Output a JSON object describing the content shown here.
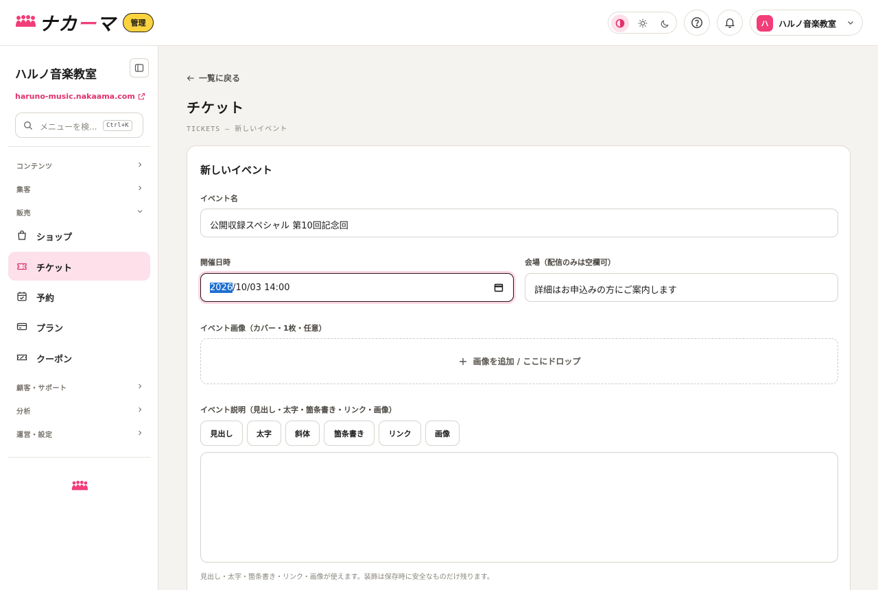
{
  "header": {
    "brand_prefix": "ナカ",
    "brand_accent": "ー",
    "brand_suffix": "マ",
    "admin_badge": "管理",
    "account_avatar": "ハ",
    "account_name": "ハルノ音楽教室",
    "theme_options": [
      "contrast",
      "light",
      "dark"
    ],
    "active_theme": "contrast"
  },
  "sidebar": {
    "title": "ハルノ音楽教室",
    "site_link": "haruno-music.nakaama.com",
    "search_placeholder": "メニューを検...",
    "search_shortcut": "Ctrl+K",
    "sections": {
      "contents": "コンテンツ",
      "marketing": "集客",
      "sales": "販売",
      "customers": "顧客・サポート",
      "analytics": "分析",
      "operations": "運営・設定"
    },
    "items": {
      "shop": "ショップ",
      "tickets": "チケット",
      "reservations": "予約",
      "plans": "プラン",
      "coupons": "クーポン"
    }
  },
  "main": {
    "back_link": "一覧に戻る",
    "title": "チケット",
    "subtitle": "TICKETS — 新しいイベント",
    "form": {
      "card_title": "新しいイベント",
      "name_label": "イベント名",
      "name_value": "公開収録スペシャル 第10回記念回",
      "date_label": "開催日時",
      "date_year": "2026",
      "date_rest": "/10/03 14:00",
      "venue_label": "会場（配信のみは空欄可）",
      "venue_value": "詳細はお申込みの方にご案内します",
      "image_label": "イベント画像（カバー・1枚・任意）",
      "image_drop": "画像を追加 / ここにドロップ",
      "desc_label": "イベント説明（見出し・太字・箇条書き・リンク・画像）",
      "toolbar": [
        "見出し",
        "太字",
        "斜体",
        "箇条書き",
        "リンク",
        "画像"
      ],
      "hint": "見出し・太字・箇条書き・リンク・画像が使えます。装飾は保存時に安全なものだけ残ります。"
    }
  },
  "colors": {
    "accent": "#f23d78",
    "accent_soft": "#fde0ea",
    "badge": "#fbd33f",
    "background": "#f5f3ef"
  }
}
